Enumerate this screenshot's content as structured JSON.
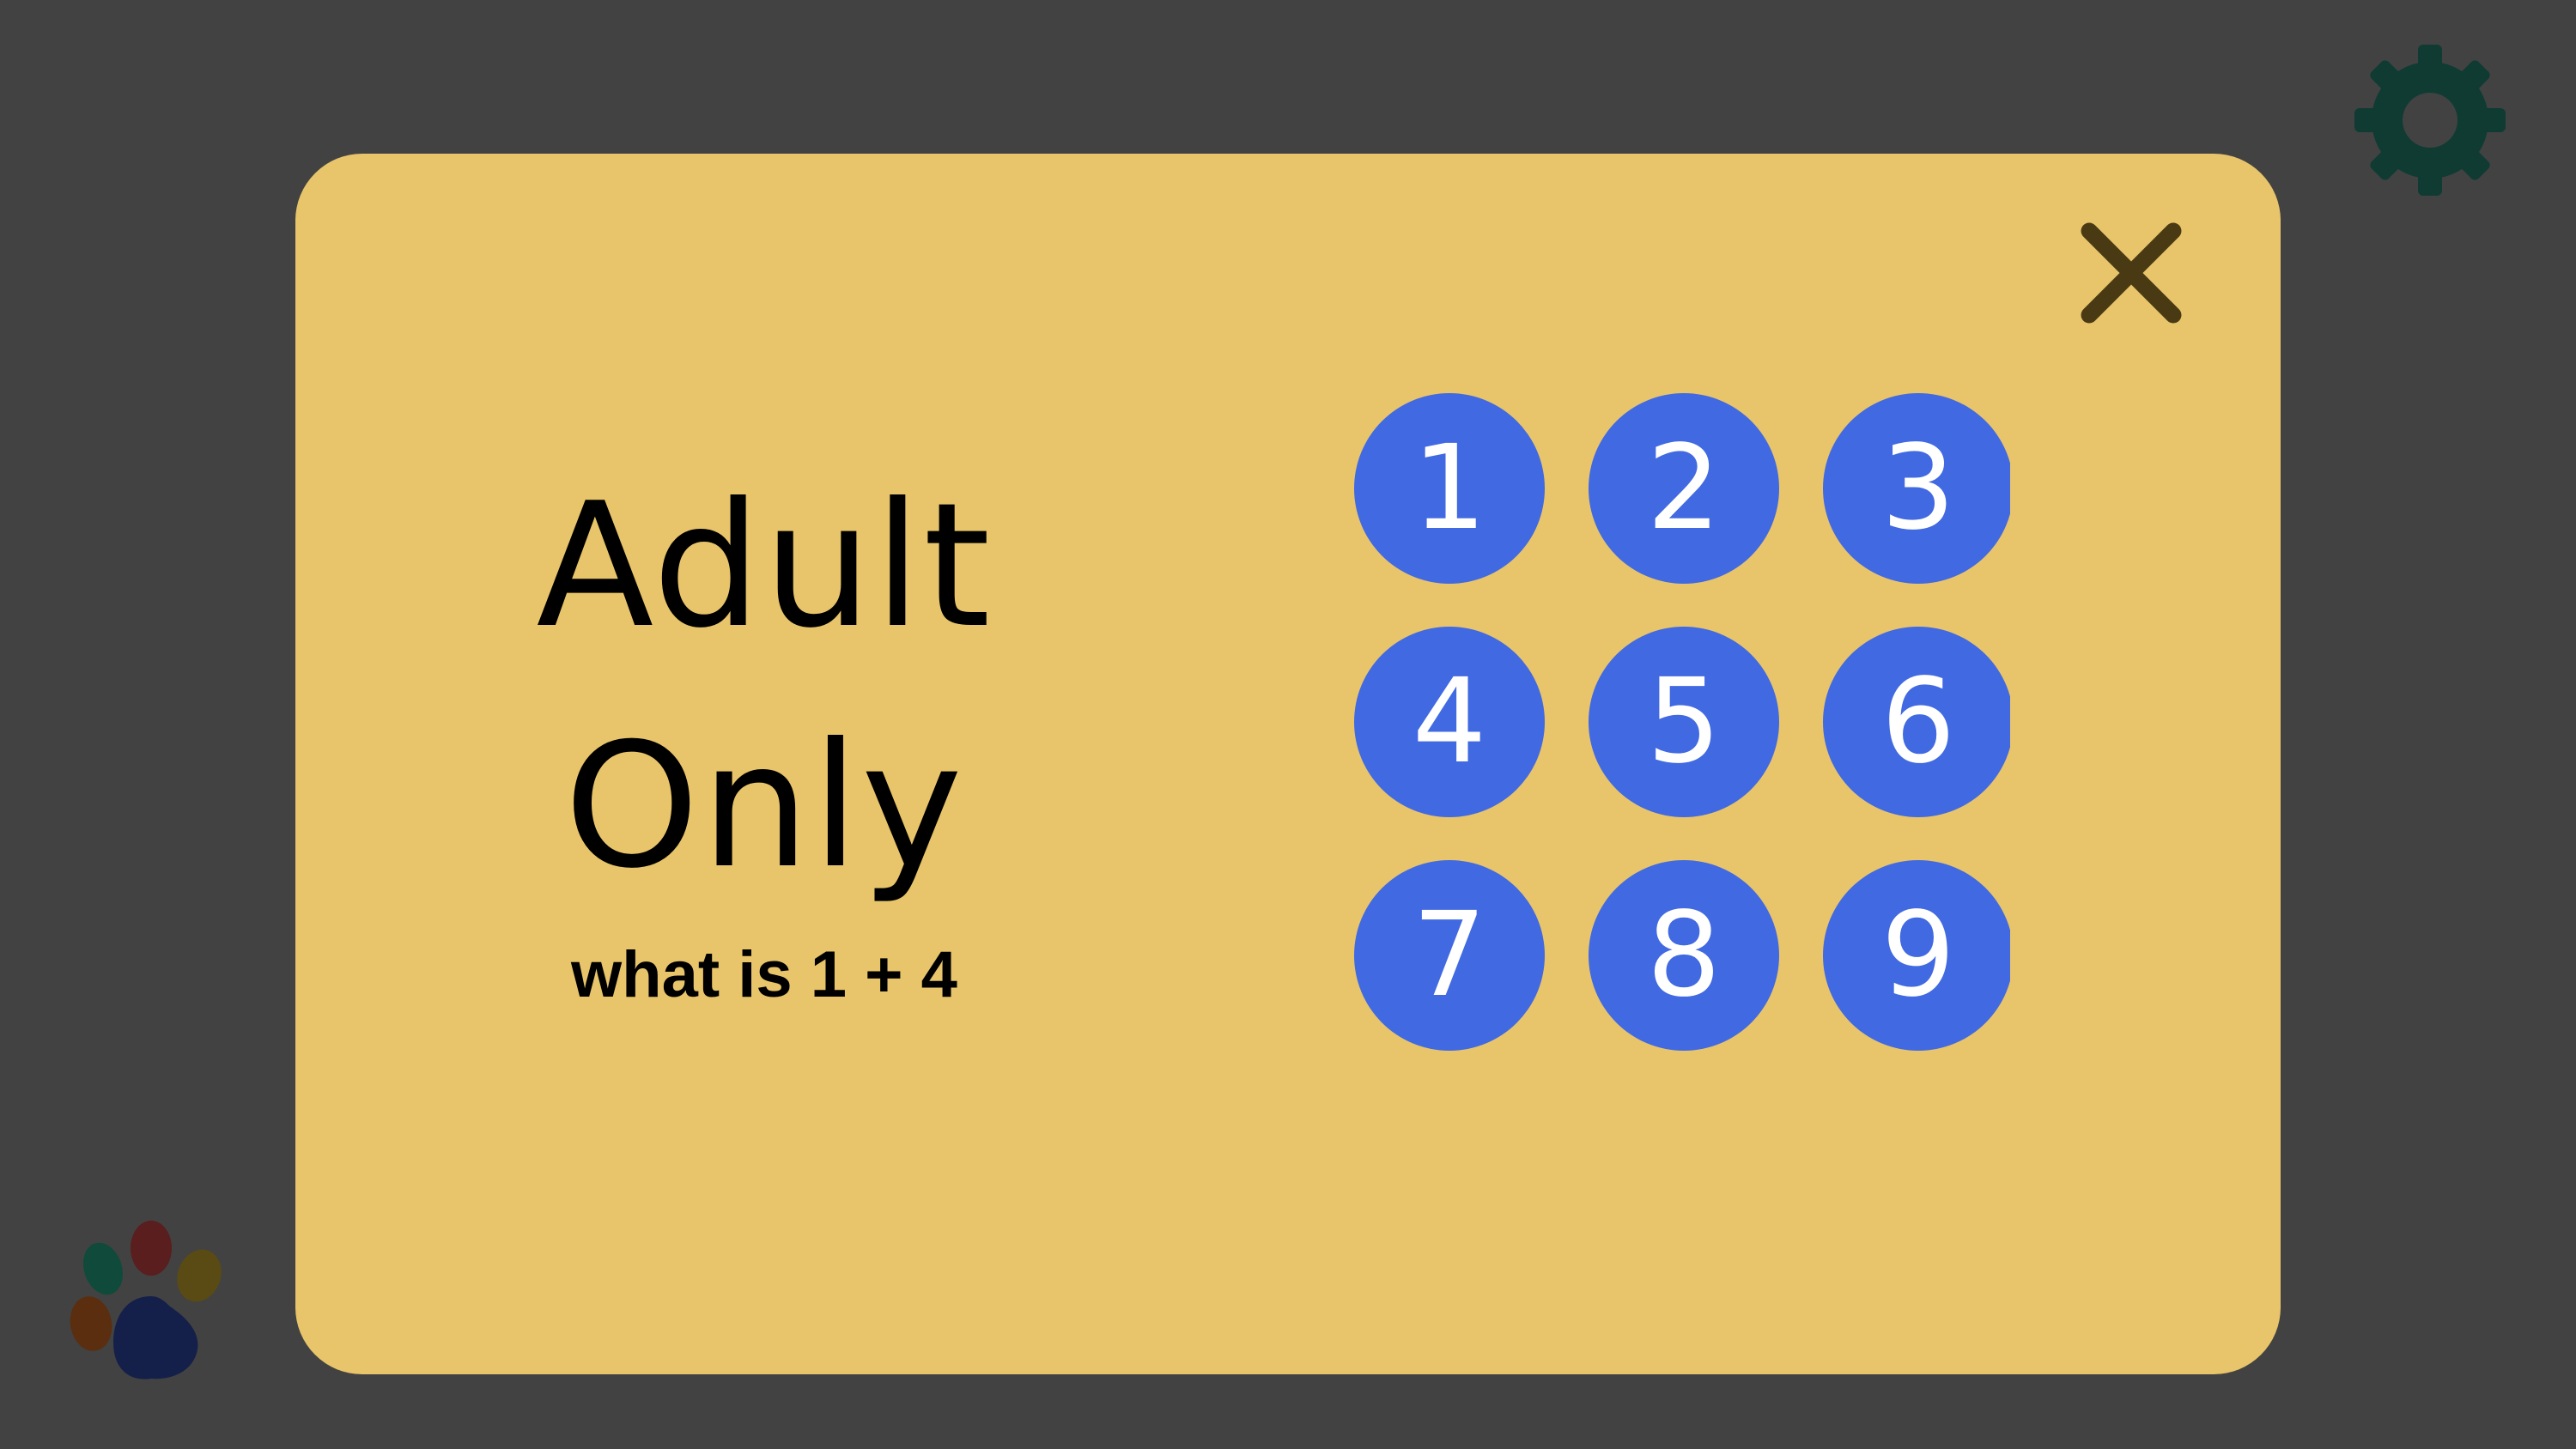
{
  "dialog": {
    "title_line1": "Adult",
    "title_line2": "Only",
    "question": "what is 1 + 4",
    "close_icon": "close-icon"
  },
  "keypad": {
    "keys": [
      "1",
      "2",
      "3",
      "4",
      "5",
      "6",
      "7",
      "8",
      "9"
    ]
  },
  "toolbar": {
    "settings_icon": "gear-icon"
  },
  "branding": {
    "logo_icon": "paw-icon"
  },
  "colors": {
    "background": "#424242",
    "dialog": "#E8C46A",
    "key": "#4169E1",
    "key_text": "#FFFFFF",
    "gear": "#0F3B33",
    "close": "#4A3A14"
  }
}
